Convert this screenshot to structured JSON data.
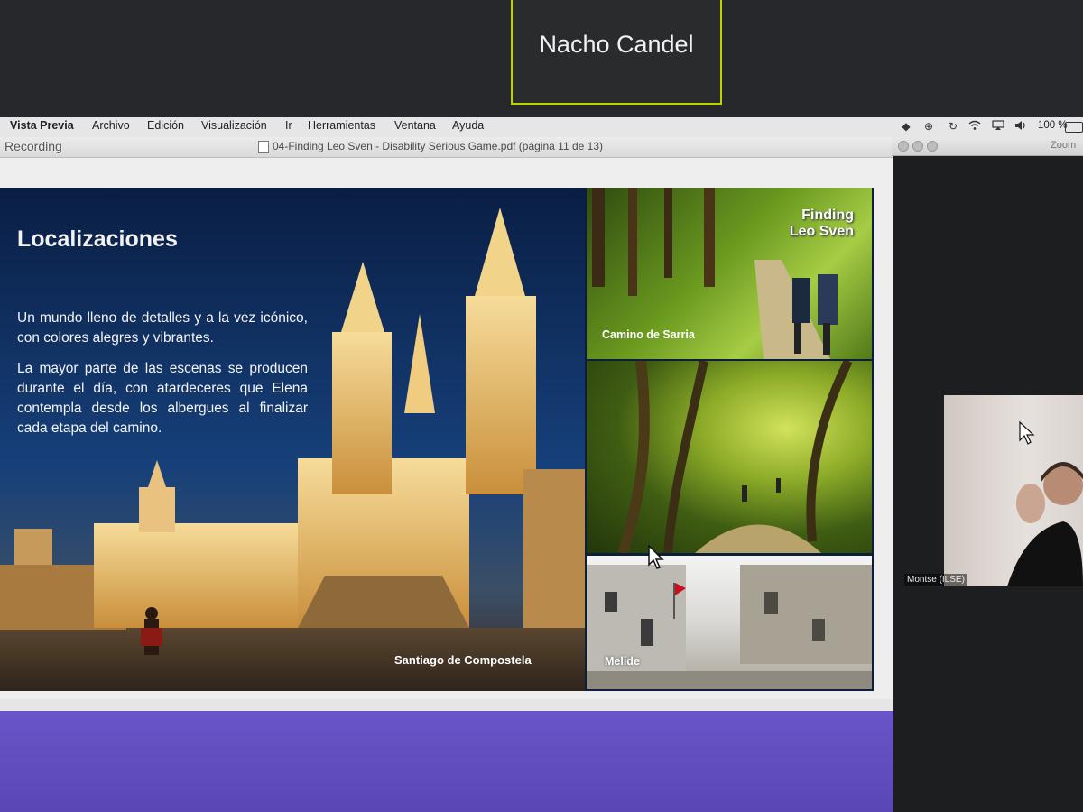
{
  "meeting": {
    "speaker_name": "Nacho Candel",
    "interpreter_label": "Montse (ILSE)"
  },
  "menubar": {
    "app_name": "Vista Previa",
    "items": [
      "Archivo",
      "Edición",
      "Visualización",
      "Ir",
      "Herramientas",
      "Ventana",
      "Ayuda"
    ],
    "battery": "100 %",
    "tray_icons": [
      "dropbox-icon",
      "accessibility-icon",
      "wifi-icon",
      "airplay-icon",
      "volume-icon"
    ]
  },
  "window": {
    "recording_label": "Recording",
    "document_title": "04-Finding Leo Sven - Disability Serious Game.pdf (página 11 de 13)"
  },
  "zoom_window": {
    "title": "Zoom"
  },
  "slide": {
    "title": "Localizaciones",
    "paragraph_1": "Un mundo lleno de detalles y a la vez icónico, con colores alegres y vibrantes.",
    "paragraph_2": "La mayor parte de las escenas se producen durante el día, con atardeceres que Elena contempla desde los albergues al finalizar cada etapa del camino.",
    "brand_logo": "Finding Leo Sven",
    "captions": {
      "santiago": "Santiago de Compostela",
      "sarria": "Camino de Sarria",
      "melide": "Melide"
    }
  },
  "colors": {
    "speaker_border": "#b9d400",
    "purple_background": "#5e4bbd"
  }
}
